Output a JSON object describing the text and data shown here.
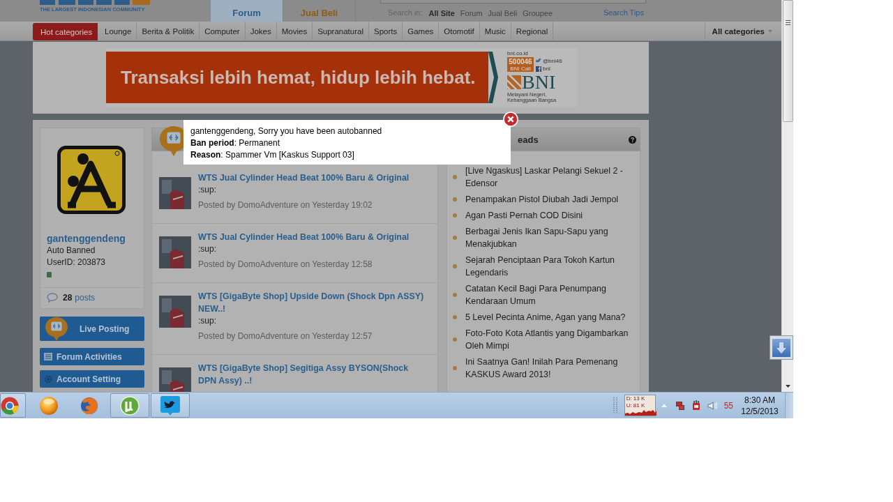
{
  "header": {
    "tagline": "THE LARGEST INDONESIAN COMMUNITY",
    "tabs": [
      {
        "label": "Forum",
        "selected": true
      },
      {
        "label": "Jual Beli",
        "selected": false
      }
    ],
    "search": {
      "label": "Search in:",
      "scopes": [
        {
          "label": "All Site",
          "selected": true
        },
        {
          "label": "Forum",
          "selected": false
        },
        {
          "label": "Jual Beli",
          "selected": false
        },
        {
          "label": "Groupee",
          "selected": false
        }
      ],
      "tips": "Search Tips"
    }
  },
  "nav": {
    "hot": "Hot categories",
    "items": [
      "Lounge",
      "Berita & Politik",
      "Computer",
      "Jokes",
      "Movies",
      "Supranatural",
      "Sports",
      "Games",
      "Otomotif",
      "Music",
      "Regional"
    ],
    "all": "All categories"
  },
  "ad": {
    "slogan": "Transaksi lebih hemat, hidup lebih hebat.",
    "site": "bni.co.id",
    "hotline": "500046",
    "hotline_label": "BNI Call",
    "twitter": "@bni46",
    "facebook": "bni",
    "brand": "BNI",
    "motto": "Melayani Negeri, Kebanggaan Bangsa"
  },
  "profile": {
    "username": "gantenggendeng",
    "status": "Auto Banned",
    "user_id": "UserID: 203873",
    "post_count": "28",
    "posts_label": "posts"
  },
  "menu": [
    {
      "kind": "live",
      "label": "Live Posting"
    },
    {
      "kind": "activities",
      "label": "Forum Activities"
    },
    {
      "kind": "settings",
      "label": "Account Setting"
    }
  ],
  "threads": [
    {
      "title": "WTS Jual Cylinder Head Beat 100% Baru & Original",
      "excerpt": ":sup:",
      "meta": "Posted by DomoAdventure on Yesterday 19:02"
    },
    {
      "title": "WTS Jual Cylinder Head Beat 100% Baru & Original",
      "excerpt": ":sup:",
      "meta": "Posted by DomoAdventure on Yesterday 12:58"
    },
    {
      "title": "WTS [GigaByte Shop] Upside Down (Shock Dpn ASSY) NEW..!",
      "excerpt": ":sup:",
      "meta": "Posted by DomoAdventure on Yesterday 12:57"
    },
    {
      "title": "WTS [GigaByte Shop] Segitiga Assy BYSON(Shock DPN Assy) ..!"
    }
  ],
  "hot_threads": {
    "title": "eads",
    "items": [
      "[Live Ngaskus] Laskar Pelangi Sekuel 2 - Edensor",
      "Penampakan Pistol Diubah Jadi Jempol",
      "Agan Pasti Pernah COD Disini",
      "Berbagai Jenis Ikan Sapu-Sapu yang Menakjubkan",
      "Sejarah Penciptaan Para Tokoh Kartun Legendaris",
      "Catatan Kecil Bagi Para Penumpang Kendaraan Umum",
      "5 Level Pecinta Anime, Agan yang Mana?",
      "Foto-Foto Kota Atlantis yang Digambarkan Oleh Mimpi",
      "Ini Saatnya Gan! Inilah Para Pemenang KASKUS Award 2013!"
    ]
  },
  "popup": {
    "lines": [
      "gantenggendeng, Sorry you have been autobanned",
      "**Ban period**: Permanent",
      "**Reason**: Spammer Vm [Kaskus Support 03]"
    ]
  },
  "taskbar": {
    "apps": [
      {
        "kind": "ring",
        "running": true
      },
      {
        "kind": "ball",
        "running": false
      },
      {
        "kind": "fox",
        "running": false
      },
      {
        "kind": "mu",
        "running": true
      },
      {
        "kind": "bird",
        "running": true
      }
    ],
    "net_down": "D: 13 K",
    "net_up": "U: 81 K",
    "tray_count": "55",
    "time": "8:30 AM",
    "date": "12/5/2013"
  }
}
